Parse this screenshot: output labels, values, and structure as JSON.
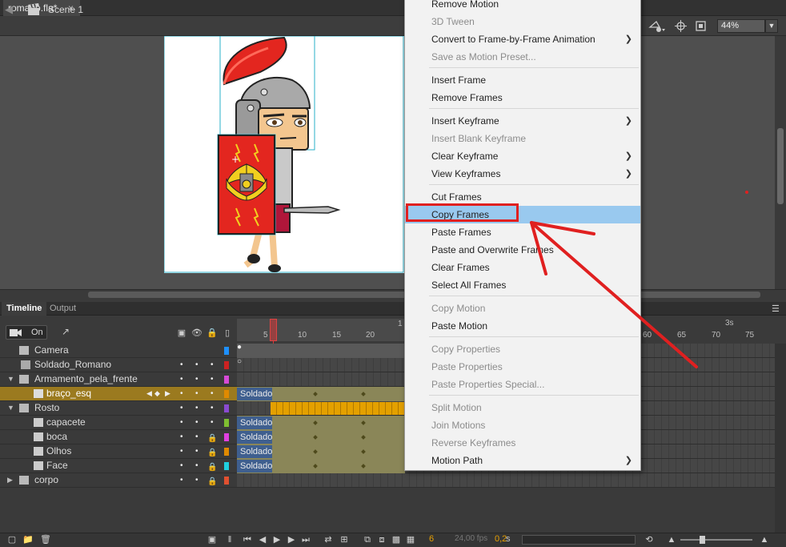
{
  "tab": {
    "title": "romano.fla*",
    "close": "×"
  },
  "editbar": {
    "scene": "Scene 1",
    "zoom": "44%"
  },
  "panels": {
    "timeline": "Timeline",
    "output": "Output"
  },
  "toolbar": {
    "camera_toggle": "On"
  },
  "ruler": {
    "ticks": [
      "5",
      "10",
      "15",
      "20",
      "60",
      "65",
      "70",
      "75"
    ],
    "marker": "3s",
    "cut": "1"
  },
  "layers": [
    {
      "name": "Camera",
      "color": "#1e90ff",
      "type": "camera"
    },
    {
      "name": "Soldado_Romano",
      "color": "#cc2222",
      "type": "layer"
    },
    {
      "name": "Armamento_pela_frente",
      "color": "#d64ad6",
      "type": "folder"
    },
    {
      "name": "braço_esq",
      "color": "#e08a00",
      "type": "layer",
      "selected": true
    },
    {
      "name": "Rosto",
      "color": "#8a4ad0",
      "type": "folder"
    },
    {
      "name": "capacete",
      "color": "#7fbf30",
      "type": "layer"
    },
    {
      "name": "boca",
      "color": "#e040e0",
      "type": "layer"
    },
    {
      "name": "Olhos",
      "color": "#e08a00",
      "type": "layer"
    },
    {
      "name": "Face",
      "color": "#20d0e0",
      "type": "layer"
    },
    {
      "name": "corpo",
      "color": "#e05030",
      "type": "folder"
    }
  ],
  "frame_label": "Soldado",
  "status": {
    "frame": "6",
    "fps": "24,00 fps",
    "seconds": "0,2",
    "seconds_unit": "s"
  },
  "context_menu": {
    "items": [
      {
        "label": "Remove Motion",
        "disabled": false
      },
      {
        "label": "3D Tween",
        "disabled": true
      },
      {
        "label": "Convert to Frame-by-Frame Animation",
        "disabled": false,
        "submenu": true
      },
      {
        "label": "Save as Motion Preset...",
        "disabled": true
      },
      {
        "label": "Insert Frame",
        "disabled": false
      },
      {
        "label": "Remove Frames",
        "disabled": false
      },
      {
        "label": "Insert Keyframe",
        "disabled": false,
        "submenu": true
      },
      {
        "label": "Insert Blank Keyframe",
        "disabled": true
      },
      {
        "label": "Clear Keyframe",
        "disabled": false,
        "submenu": true
      },
      {
        "label": "View Keyframes",
        "disabled": false,
        "submenu": true
      },
      {
        "label": "Cut Frames",
        "disabled": false
      },
      {
        "label": "Copy Frames",
        "disabled": false,
        "highlighted": true
      },
      {
        "label": "Paste Frames",
        "disabled": false
      },
      {
        "label": "Paste and Overwrite Frames",
        "disabled": false
      },
      {
        "label": "Clear Frames",
        "disabled": false
      },
      {
        "label": "Select All Frames",
        "disabled": false
      },
      {
        "label": "Copy Motion",
        "disabled": true
      },
      {
        "label": "Paste Motion",
        "disabled": false
      },
      {
        "label": "Copy Properties",
        "disabled": true
      },
      {
        "label": "Paste Properties",
        "disabled": true
      },
      {
        "label": "Paste Properties Special...",
        "disabled": true
      },
      {
        "label": "Split Motion",
        "disabled": true
      },
      {
        "label": "Join Motions",
        "disabled": true
      },
      {
        "label": "Reverse Keyframes",
        "disabled": true
      },
      {
        "label": "Motion Path",
        "disabled": false,
        "submenu": true
      }
    ]
  },
  "colors": {
    "highlight": "#99c9ef",
    "annotation_red": "#e02020",
    "selected_layer": "#9b7a1f"
  }
}
